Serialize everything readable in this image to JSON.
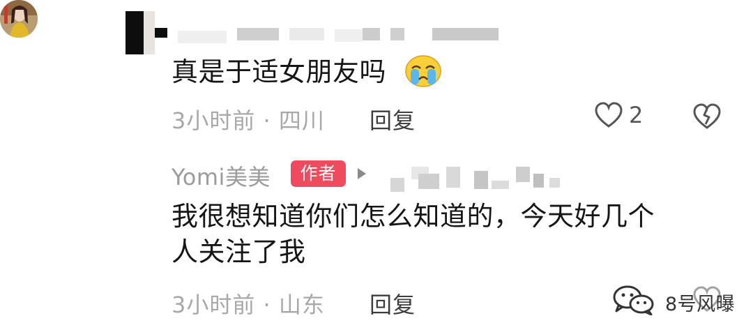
{
  "comments": [
    {
      "text": "真是于适女朋友吗",
      "emoji": "crying-face-emoji",
      "time_location": "3小时前 · 四川",
      "reply_label": "回复",
      "like_count": "2"
    },
    {
      "username": "Yomi美美",
      "author_badge": "作者",
      "text_line1": "我很想知道你们怎么知道的，今天好几个",
      "text_line2": "人关注了我",
      "time_location": "3小时前 · 山东",
      "reply_label": "回复"
    }
  ],
  "watermark": {
    "text": "8号风曝"
  },
  "colors": {
    "author_badge": "#ef4a5e",
    "meta_gray": "#a8a8a8",
    "text_dark": "#161616",
    "icon_gray": "#555555"
  }
}
